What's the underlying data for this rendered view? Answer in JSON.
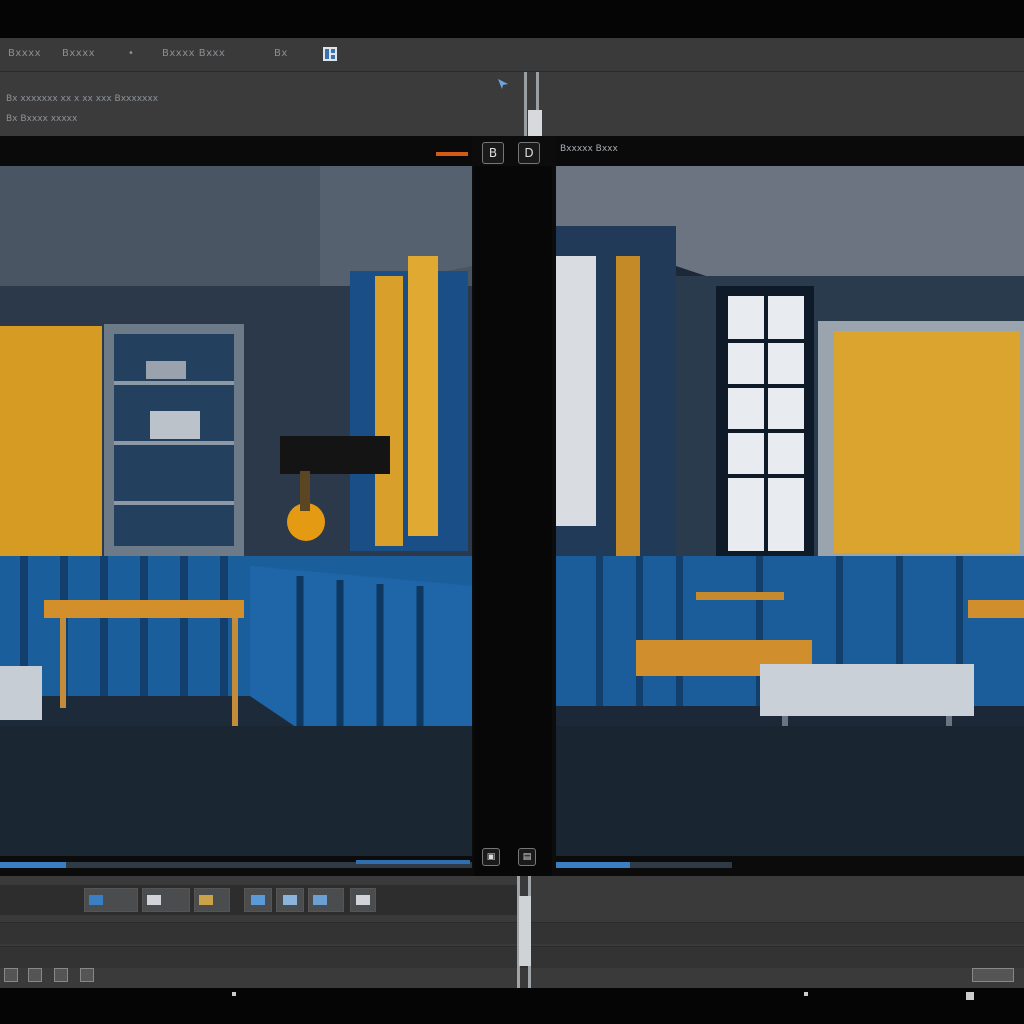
{
  "app": {
    "menu": [
      "Bxxxx",
      "Bxxxx",
      "Bxxxx Bxxx",
      "Bx"
    ],
    "info_lines": [
      "Bx xxxxxxx xx x xx xxx Bxxxxxxx",
      "Bx Bxxxx xxxxx"
    ]
  },
  "viewers": {
    "left": {
      "title": "",
      "progress": 0.14
    },
    "right": {
      "title": "Bxxxxx Bxxx",
      "progress": 0.42
    }
  },
  "divider": {
    "top_left_label": "B",
    "top_right_label": "D"
  },
  "colors": {
    "accent": "#3a7fc4",
    "marker": "#d45a18",
    "panel": "#3a3a3b",
    "sofa_blue": "#1d5f9a",
    "wall_gold": "#d9a02a"
  },
  "icons": [
    "grid-icon",
    "cursor-icon",
    "playhead-icon",
    "layout-icon",
    "film-icon",
    "image-icon"
  ]
}
